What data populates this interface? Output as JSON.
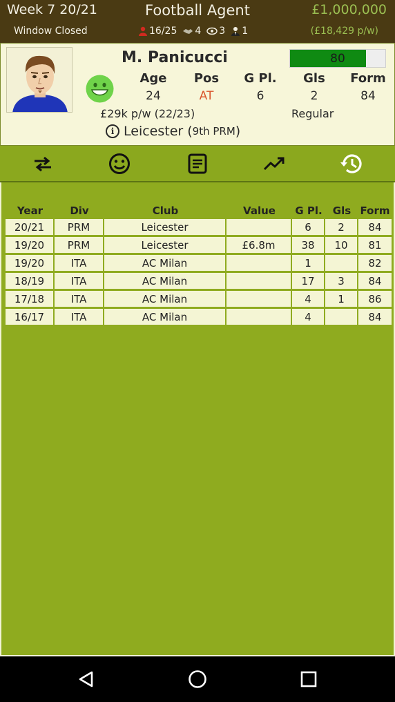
{
  "header": {
    "week": "Week 7 20/21",
    "app_title": "Football Agent",
    "money": "£1,000,000",
    "window_status": "Window Closed",
    "stats": {
      "players": "16/25",
      "shake": "4",
      "scouts": "3",
      "staff": "1"
    },
    "wage": "(£18,429 p/w)"
  },
  "player": {
    "name": "M. Panicucci",
    "rating": 80,
    "rating_label": "80",
    "stat_headers": {
      "age": "Age",
      "pos": "Pos",
      "games": "G Pl.",
      "goals": "Gls",
      "form": "Form"
    },
    "stat_values": {
      "age": "24",
      "pos": "AT",
      "games": "6",
      "goals": "2",
      "form": "84"
    },
    "contract": "£29k p/w (22/23)",
    "status": "Regular",
    "club_prefix": "Leicester (",
    "club_rank": "9th PRM",
    "club_suffix": ")",
    "info_glyph": "i"
  },
  "tabs": [
    {
      "icon": "transfer-icon"
    },
    {
      "icon": "smiley-icon"
    },
    {
      "icon": "notes-icon"
    },
    {
      "icon": "trend-icon"
    },
    {
      "icon": "history-icon"
    }
  ],
  "history": {
    "headers": {
      "year": "Year",
      "div": "Div",
      "club": "Club",
      "value": "Value",
      "games": "G Pl.",
      "goals": "Gls",
      "form": "Form"
    },
    "rows": [
      {
        "year": "20/21",
        "div": "PRM",
        "club": "Leicester",
        "value": "",
        "games": "6",
        "goals": "2",
        "form": "84"
      },
      {
        "year": "19/20",
        "div": "PRM",
        "club": "Leicester",
        "value": "£6.8m",
        "games": "38",
        "goals": "10",
        "form": "81"
      },
      {
        "year": "19/20",
        "div": "ITA",
        "club": "AC Milan",
        "value": "",
        "games": "1",
        "goals": "",
        "form": "82"
      },
      {
        "year": "18/19",
        "div": "ITA",
        "club": "AC Milan",
        "value": "",
        "games": "17",
        "goals": "3",
        "form": "84"
      },
      {
        "year": "17/18",
        "div": "ITA",
        "club": "AC Milan",
        "value": "",
        "games": "4",
        "goals": "1",
        "form": "86"
      },
      {
        "year": "16/17",
        "div": "ITA",
        "club": "AC Milan",
        "value": "",
        "games": "4",
        "goals": "",
        "form": "84"
      }
    ]
  },
  "colors": {
    "header_bg": "#4a3a13",
    "accent_green": "#9bbf52",
    "main_bg": "#8fab1f",
    "rating_fill": "#0f8a12",
    "position": "#d9542b"
  }
}
